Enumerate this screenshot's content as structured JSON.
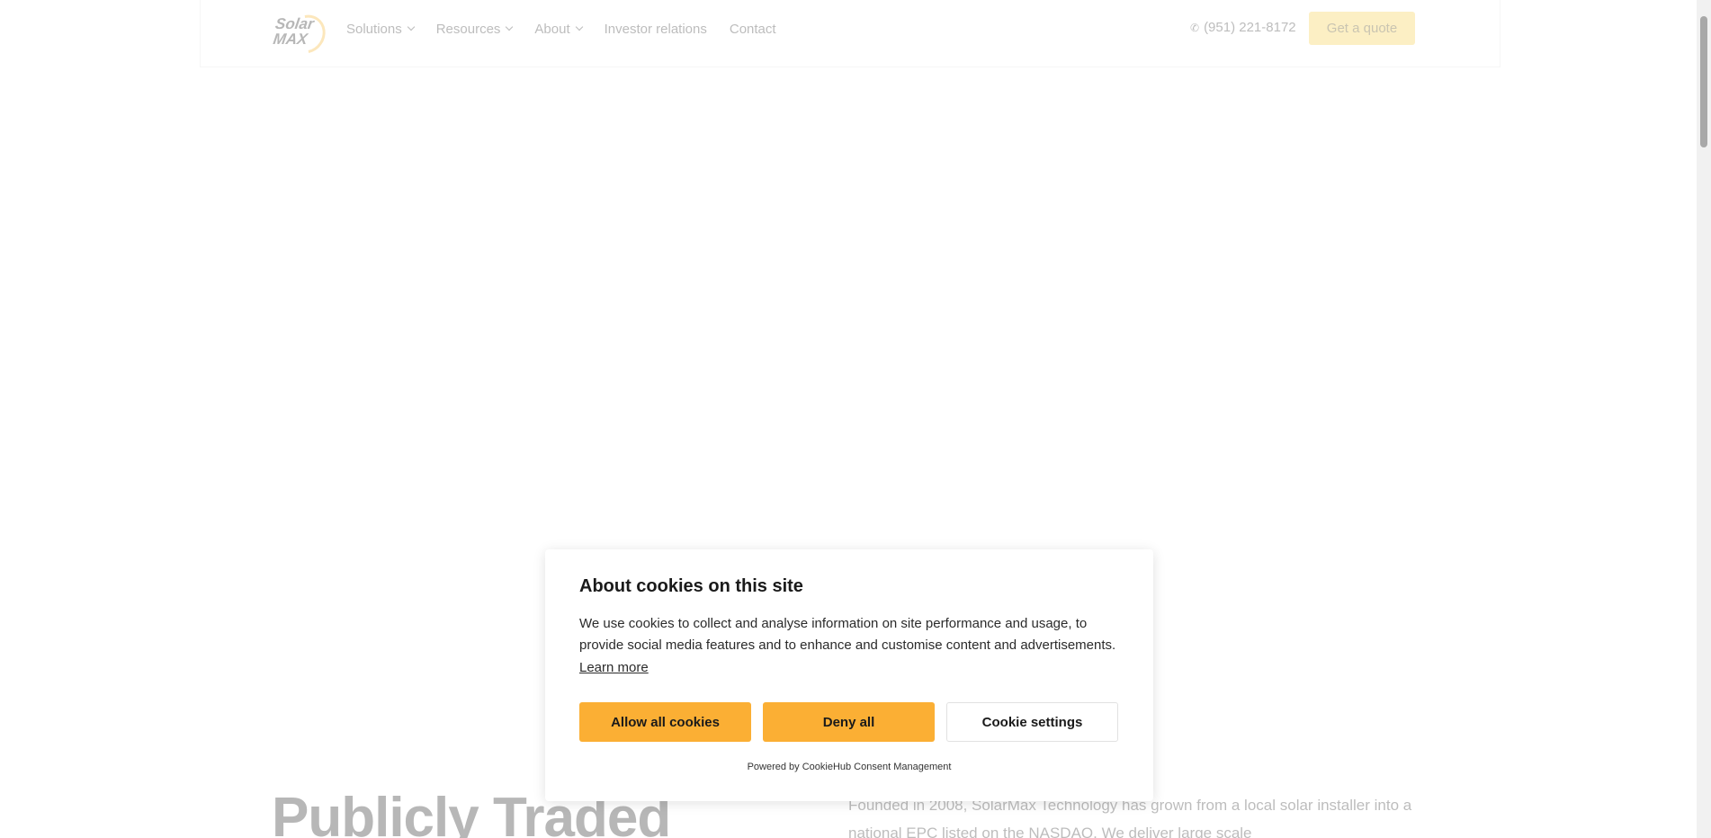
{
  "header": {
    "logo_text": "Solar MAX",
    "nav": [
      {
        "label": "Solutions",
        "has_dropdown": true
      },
      {
        "label": "Resources",
        "has_dropdown": true
      },
      {
        "label": "About",
        "has_dropdown": true
      },
      {
        "label": "Investor relations",
        "has_dropdown": false
      },
      {
        "label": "Contact",
        "has_dropdown": false
      }
    ],
    "phone": "(951) 221-8172",
    "cta_label": "Get a quote"
  },
  "hero": {
    "title": "Publicly Traded",
    "paragraph": "Founded in 2008, SolarMax Technology has grown from a local solar installer into a national EPC listed on the NASDAQ. We deliver large scale"
  },
  "cookie_dialog": {
    "title": "About cookies on this site",
    "text": "We use cookies to collect and analyse information on site performance and usage, to provide social media features and to enhance and customise content and advertisements.",
    "learn_more": "Learn more",
    "allow_label": "Allow all cookies",
    "deny_label": "Deny all",
    "settings_label": "Cookie settings",
    "powered_by": "Powered by CookieHub Consent Management"
  },
  "colors": {
    "accent": "#fbaf34",
    "cta": "#f7d04a"
  }
}
